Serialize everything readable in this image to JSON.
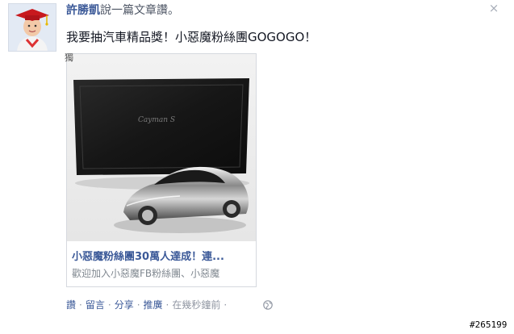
{
  "post": {
    "author": "許勝凱",
    "action_text": "說一篇文章讚。",
    "message": "我要抽汽車精品獎！小惡魔粉絲團GOGOGO！",
    "close_glyph": "×",
    "tiny_glyph": "獨",
    "photo_logo_text": "Cayman S",
    "card": {
      "title": "小惡魔粉絲團30萬人達成！連...",
      "description": "歡迎加入小惡魔FB粉絲團、小惡魔"
    },
    "actions": {
      "like": "讚",
      "comment": "留言",
      "share": "分享",
      "promote": "推廣",
      "timestamp": "在幾秒鐘前",
      "separator": "·"
    }
  },
  "watermark": "#265199",
  "icons": {
    "avatar": "child-in-graduation-cap-avatar",
    "close": "close-icon",
    "privacy": "globe-icon"
  },
  "colors": {
    "link_blue": "#3b5998",
    "meta_gray": "#9197a3",
    "card_border": "#d6d9df"
  }
}
